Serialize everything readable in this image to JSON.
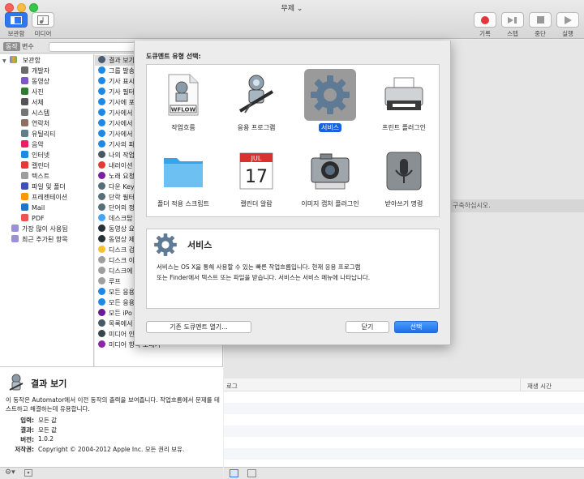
{
  "window": {
    "title": "무제 ⌄"
  },
  "toolbar": {
    "left": [
      {
        "label": "보관함",
        "icon": "library-icon"
      },
      {
        "label": "미디어",
        "icon": "media-icon"
      }
    ],
    "right": [
      {
        "label": "기록",
        "icon": "record-icon"
      },
      {
        "label": "스텝",
        "icon": "step-icon"
      },
      {
        "label": "중단",
        "icon": "stop-icon"
      },
      {
        "label": "실행",
        "icon": "run-icon"
      }
    ]
  },
  "segments": {
    "actions": "동작",
    "variables": "변수"
  },
  "search": {
    "placeholder": "이"
  },
  "library": {
    "root": "보관함",
    "items": [
      "개발자",
      "동영상",
      "사진",
      "서체",
      "시스템",
      "연락처",
      "유틸리티",
      "음악",
      "인터넷",
      "캘린더",
      "텍스트",
      "파일 및 폴더",
      "프레젠테이션",
      "Mail",
      "PDF"
    ],
    "smart": [
      "가장 많이 사용됨",
      "최근 추가된 항목"
    ]
  },
  "actions": [
    "결과 보기",
    "그룹 발송",
    "기사 표시",
    "기사 필터",
    "기사에 포",
    "기사에서",
    "기사에서",
    "기사에서",
    "기사의 파",
    "나의 작업",
    "내러이션",
    "노래 요청",
    "다운 Key",
    "단락 필터",
    "단어의 정",
    "데스크탑",
    "동영상 요",
    "동영상 제",
    "디스크 검",
    "디스크 이",
    "디스크에",
    "루프",
    "모든 응용",
    "모든 응용",
    "모든 iPo",
    "목록에서",
    "미디어 인코딩",
    "미디어 항목 보내기"
  ],
  "description": {
    "title": "결과 보기",
    "text": "이 동작은 Automator에서 이전 동작의 출력을 보여줍니다. 작업흐름에서 문제를 테스트하고 해결하는데 유용합니다.",
    "fields": [
      {
        "label": "입력:",
        "value": "모든 값"
      },
      {
        "label": "결과:",
        "value": "모든 값"
      },
      {
        "label": "버전:",
        "value": "1.0.2"
      },
      {
        "label": "저작권:",
        "value": "Copyright © 2004-2012 Apple Inc.  모든 권리 보유."
      }
    ]
  },
  "workflow": {
    "hint": "구축하십시오."
  },
  "log": {
    "col_log": "로그",
    "col_time": "재생 시간"
  },
  "sheet": {
    "heading": "도큐멘트 유형 선택:",
    "types": [
      {
        "name": "작업흐름",
        "icon": "workflow-icon"
      },
      {
        "name": "응용 프로그램",
        "icon": "application-icon"
      },
      {
        "name": "서비스",
        "icon": "service-gear-icon",
        "selected": true
      },
      {
        "name": "프린트 플러그인",
        "icon": "printer-icon"
      },
      {
        "name": "폴더 적용 스크립트",
        "icon": "folder-icon"
      },
      {
        "name": "캘린더 알람",
        "icon": "calendar-icon"
      },
      {
        "name": "이미지 캡처 플러그인",
        "icon": "camera-icon"
      },
      {
        "name": "받아쓰기 명령",
        "icon": "microphone-icon"
      }
    ],
    "wflow_tag": "WFLOW",
    "cal_month": "JUL",
    "cal_day": "17",
    "detail_title": "서비스",
    "detail_text_1": "서비스는 OS X을 통해 사용할 수 있는 빠른 작업흐름입니다. 현재 응용 프로그램",
    "detail_text_2": "또는 Finder에서 텍스트 또는 파일을 받습니다. 서비스는 서비스 메뉴에 나타납니다.",
    "open_existing": "기존 도큐멘트 열기...",
    "close": "닫기",
    "choose": "선택"
  }
}
